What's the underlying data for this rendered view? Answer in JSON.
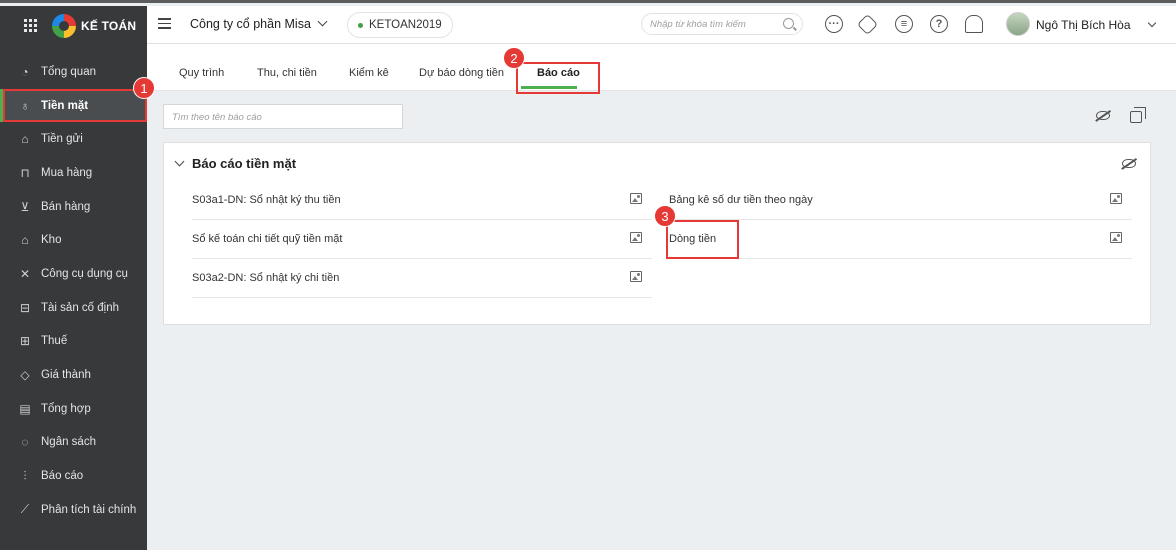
{
  "app": {
    "brand": "KẾ TOÁN"
  },
  "header": {
    "company": "Công ty cổ phần Misa",
    "database": "KETOAN2019",
    "search_placeholder": "Nhập từ khóa tìm kiếm",
    "user_name": "Ngô Thị Bích Hòa",
    "icons": [
      "more-icon",
      "gear-icon",
      "chat-icon",
      "help-icon",
      "bell-icon"
    ]
  },
  "sidebar": {
    "items": [
      {
        "label": "Tổng quan",
        "icon": "dashboard-icon"
      },
      {
        "label": "Tiền mặt",
        "icon": "money-bag-icon",
        "active": true
      },
      {
        "label": "Tiền gửi",
        "icon": "bank-icon"
      },
      {
        "label": "Mua hàng",
        "icon": "shopping-bag-icon"
      },
      {
        "label": "Bán hàng",
        "icon": "cart-icon"
      },
      {
        "label": "Kho",
        "icon": "warehouse-icon"
      },
      {
        "label": "Công cụ dụng cụ",
        "icon": "tools-icon"
      },
      {
        "label": "Tài sản cố định",
        "icon": "car-icon"
      },
      {
        "label": "Thuế",
        "icon": "tax-icon"
      },
      {
        "label": "Giá thành",
        "icon": "price-tag-icon"
      },
      {
        "label": "Tổng hợp",
        "icon": "book-icon"
      },
      {
        "label": "Ngân sách",
        "icon": "budget-icon"
      },
      {
        "label": "Báo cáo",
        "icon": "bar-chart-icon"
      },
      {
        "label": "Phân tích tài chính",
        "icon": "line-chart-icon"
      }
    ]
  },
  "tabs": [
    {
      "label": "Quy trình"
    },
    {
      "label": "Thu, chi tiền"
    },
    {
      "label": "Kiểm kê"
    },
    {
      "label": "Dự báo dòng tiền"
    },
    {
      "label": "Báo cáo",
      "active": true
    }
  ],
  "filter": {
    "placeholder": "Tìm theo tên báo cáo"
  },
  "panel": {
    "title": "Báo cáo tiền mặt",
    "left_reports": [
      "S03a1-DN: Sổ nhật ký thu tiền",
      "Sổ kế toán chi tiết quỹ tiền mặt",
      "S03a2-DN: Sổ nhật ký chi tiền"
    ],
    "right_reports": [
      "Bảng kê số dư tiền theo ngày",
      "Dòng tiền"
    ]
  },
  "annotations": {
    "badge1": "1",
    "badge2": "2",
    "badge3": "3"
  },
  "colors": {
    "sidebar_bg": "#37393b",
    "accent": "#4caf50",
    "highlight": "#e53935"
  }
}
